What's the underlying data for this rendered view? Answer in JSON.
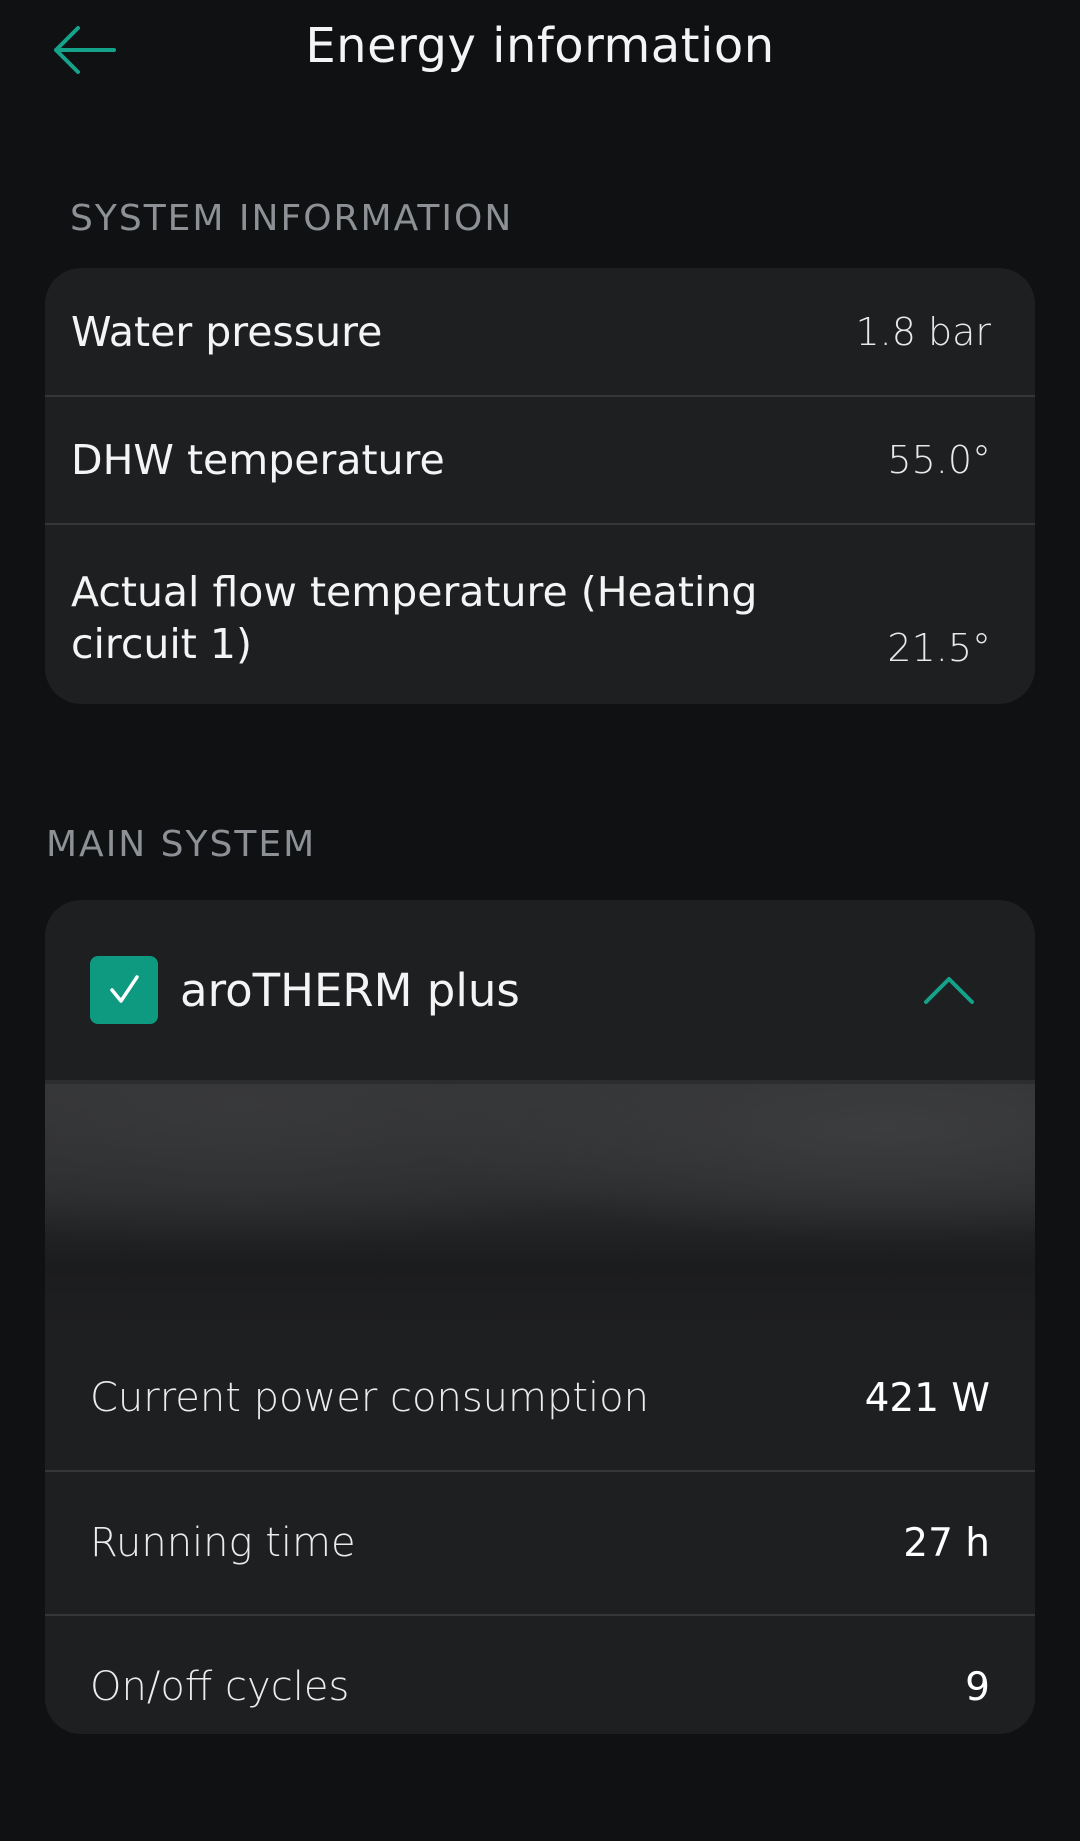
{
  "header": {
    "title": "Energy information",
    "back_icon": "arrow-left-icon"
  },
  "system_information": {
    "section_label": "SYSTEM INFORMATION",
    "rows": [
      {
        "label": "Water pressure",
        "value": "1.8 bar"
      },
      {
        "label": "DHW temperature",
        "value": "55.0°"
      },
      {
        "label": "Actual flow temperature (Heating circuit 1)",
        "value": "21.5°"
      }
    ]
  },
  "main_system": {
    "section_label": "MAIN SYSTEM",
    "device": {
      "name": "aroTHERM plus",
      "checked": true,
      "expanded": true,
      "check_icon": "checkmark-icon",
      "toggle_icon": "chevron-up-icon"
    },
    "metrics": [
      {
        "label": "Current power consumption",
        "value": "421 W"
      },
      {
        "label": "Running time",
        "value": "27 h"
      },
      {
        "label": "On/off cycles",
        "value": "9"
      }
    ]
  },
  "colors": {
    "background": "#0f1113",
    "card": "#1e1f21",
    "accent": "#0e9981",
    "divider": "#34373a",
    "section_label": "#8d9094"
  }
}
